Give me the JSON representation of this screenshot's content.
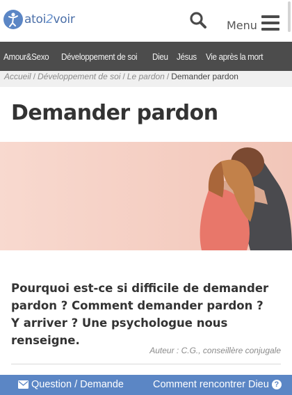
{
  "header": {
    "logo": {
      "prefix": "atoi",
      "number": "2",
      "suffix": "voir"
    },
    "menu_label": "Menu"
  },
  "nav": {
    "items": [
      {
        "label": "Amour&Sexo"
      },
      {
        "label": "Développement de soi"
      },
      {
        "label": "Dieu"
      },
      {
        "label": "Jésus"
      },
      {
        "label": "Vie après la mort"
      }
    ]
  },
  "breadcrumb": {
    "items": [
      "Accueil",
      "Développement de soi",
      "Le pardon"
    ],
    "separator": "/",
    "current": "Demander pardon"
  },
  "article": {
    "title": "Demander pardon",
    "lead": "Pourquoi est-ce si difficile de demander pardon ? Comment demander pardon ? Y arriver ? Une psychologue nous renseigne.",
    "author": "Auteur : C.G., conseillère conjugale"
  },
  "bottom_bar": {
    "question_label": "Question / Demande",
    "meet_label": "Comment rencontrer Dieu",
    "help_glyph": "?"
  },
  "colors": {
    "brand_blue": "#5b86c5",
    "nav_bg": "#4c4c4c",
    "hero_bg": "#f6d1c6"
  },
  "icons": [
    "search-icon",
    "hamburger-icon",
    "envelope-icon",
    "question-circle-icon"
  ]
}
